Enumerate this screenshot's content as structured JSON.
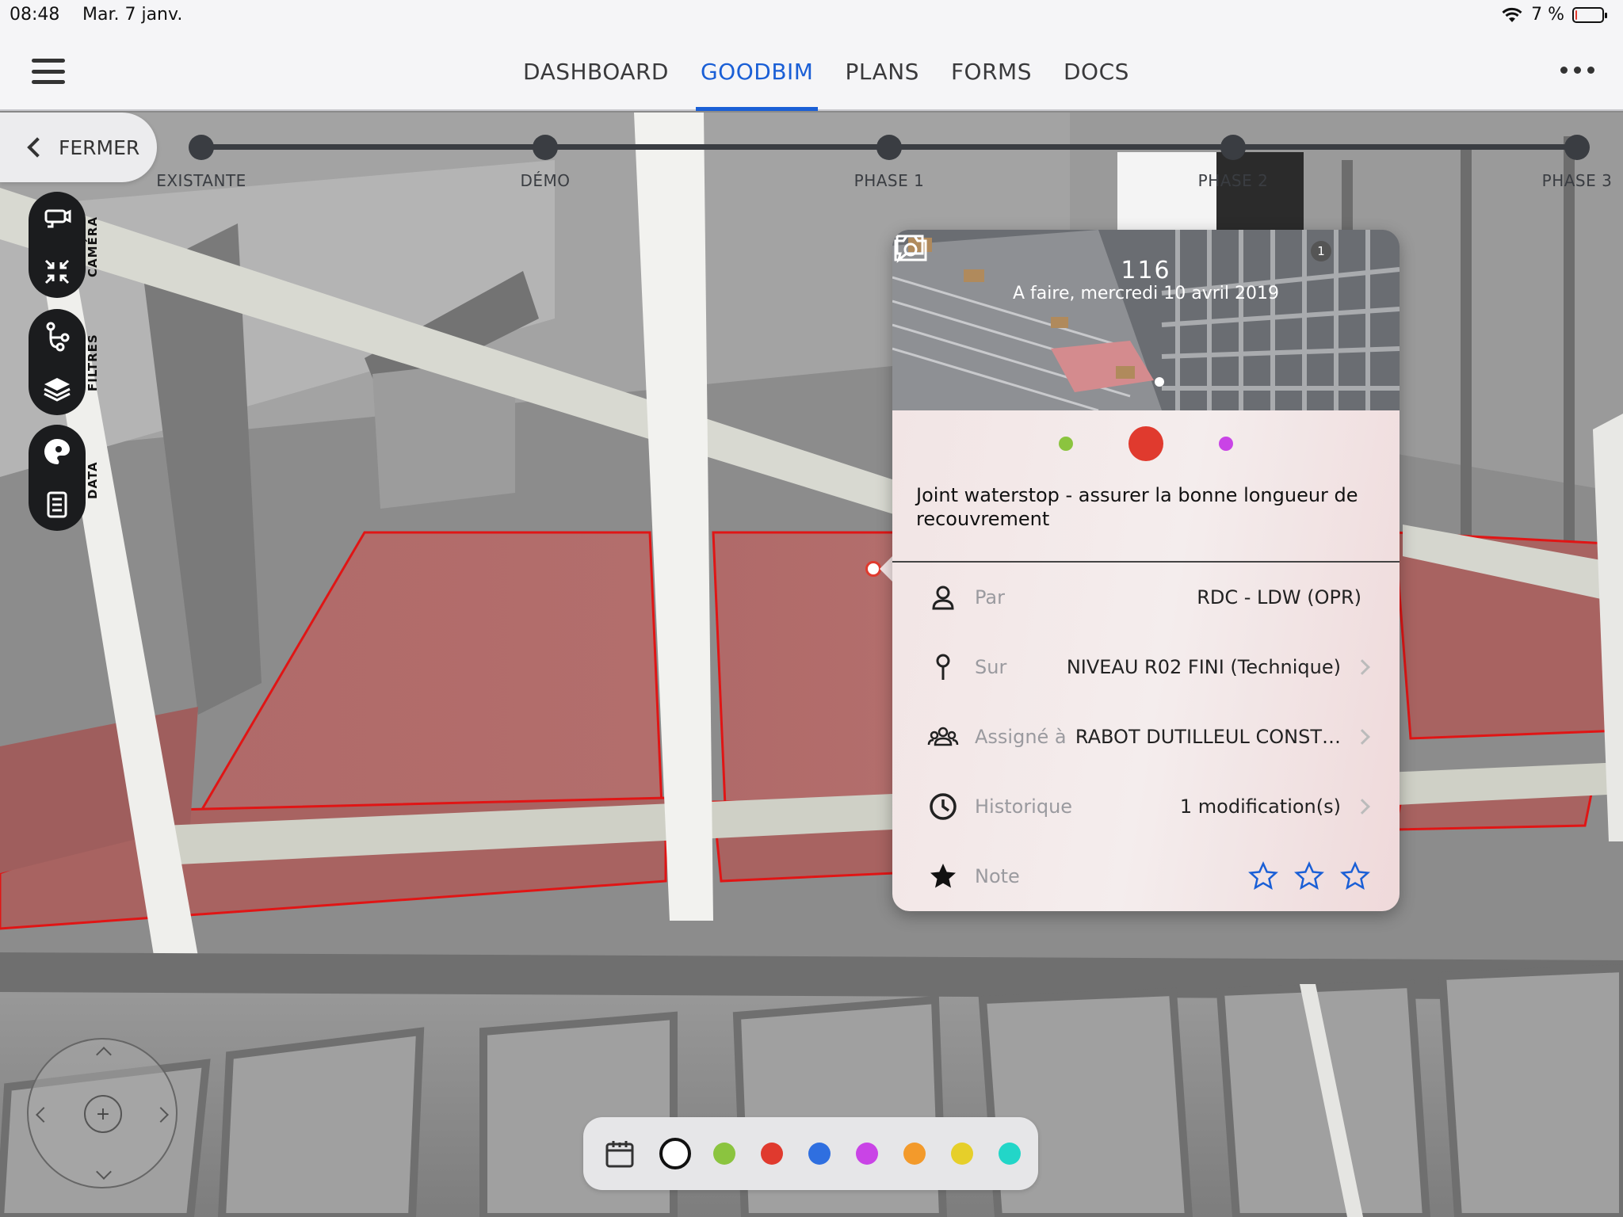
{
  "status_bar": {
    "time": "08:48",
    "date": "Mar. 7 janv.",
    "battery_text": "7 %",
    "battery_level": 0.07
  },
  "nav": {
    "tabs": [
      {
        "label": "DASHBOARD",
        "active": false
      },
      {
        "label": "GOODBIM",
        "active": true
      },
      {
        "label": "PLANS",
        "active": false
      },
      {
        "label": "FORMS",
        "active": false
      },
      {
        "label": "DOCS",
        "active": false
      }
    ],
    "menu_icon": "hamburger-icon",
    "more_icon": "more-dots-icon"
  },
  "close_button": {
    "label": "FERMER"
  },
  "timeline": {
    "phases": [
      "EXISTANTE",
      "DÉMO",
      "PHASE 1",
      "PHASE 2",
      "PHASE 3"
    ]
  },
  "toolbar": {
    "camera_label": "CAMÉRA",
    "filters_label": "FILTRES",
    "data_label": "DATA"
  },
  "card": {
    "id": "116",
    "subtitle": "A faire, mercredi 10 avril 2019",
    "comment_count": "1",
    "title": "Joint waterstop - assurer la bonne longueur de recouvrement",
    "status_colors": [
      "#8bc43f",
      "#e03a2e",
      "#c944e6"
    ],
    "rows": [
      {
        "label": "Par",
        "value": "RDC - LDW (OPR)",
        "icon": "person-icon",
        "arrow": false
      },
      {
        "label": "Sur",
        "value": "NIVEAU R02 FINI (Technique)",
        "icon": "pin-icon",
        "arrow": true
      },
      {
        "label": "Assigné à",
        "value": "RABOT DUTILLEUL CONST…",
        "icon": "group-icon",
        "arrow": true
      },
      {
        "label": "Historique",
        "value": "1 modification(s)",
        "icon": "clock-icon",
        "arrow": true
      },
      {
        "label": "Note",
        "value": "",
        "icon": "star-filled-icon",
        "arrow": false
      }
    ],
    "rating": 0,
    "rating_max": 3
  },
  "color_bar": {
    "colors": [
      "#8bc43f",
      "#e03a2e",
      "#2f6fe0",
      "#c944e6",
      "#f39a2b",
      "#e6cf2a",
      "#22d6c8"
    ]
  },
  "accent_color": "#1a5fd6"
}
